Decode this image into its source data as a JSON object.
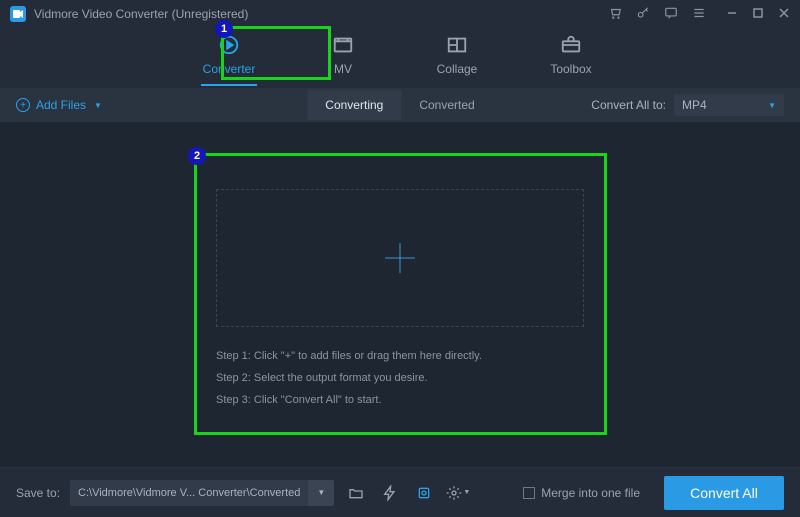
{
  "titlebar": {
    "title": "Vidmore Video Converter (Unregistered)"
  },
  "tabs": {
    "converter": "Converter",
    "mv": "MV",
    "collage": "Collage",
    "toolbox": "Toolbox"
  },
  "subbar": {
    "add_files": "Add Files",
    "converting": "Converting",
    "converted": "Converted",
    "convert_all_to": "Convert All to:",
    "format": "MP4"
  },
  "dropzone": {
    "step1": "Step 1: Click \"+\" to add files or drag them here directly.",
    "step2": "Step 2: Select the output format you desire.",
    "step3": "Step 3: Click \"Convert All\" to start."
  },
  "footer": {
    "save_to": "Save to:",
    "path": "C:\\Vidmore\\Vidmore V... Converter\\Converted",
    "merge": "Merge into one file",
    "convert_all": "Convert All"
  },
  "annot": {
    "n1": "1",
    "n2": "2"
  }
}
